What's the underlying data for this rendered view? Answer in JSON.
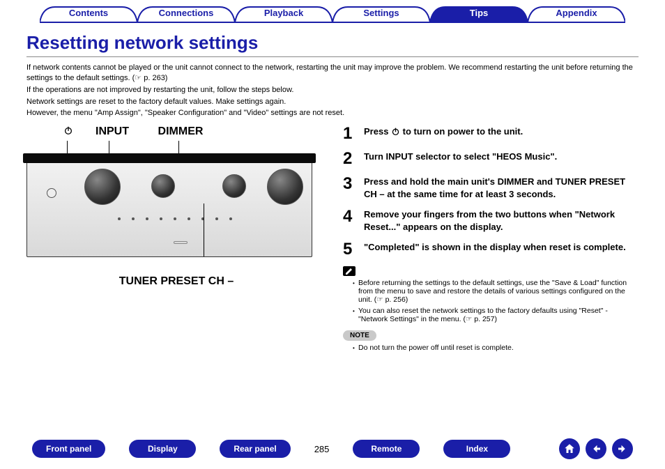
{
  "nav_tabs": {
    "items": [
      "Contents",
      "Connections",
      "Playback",
      "Settings",
      "Tips",
      "Appendix"
    ],
    "active_index": 4
  },
  "page_title": "Resetting network settings",
  "intro": {
    "p1": "If network contents cannot be played or the unit cannot connect to the network, restarting the unit may improve the problem. We recommend restarting the unit before returning the settings to the default settings. (☞ p. 263)",
    "p2": "If the operations are not improved by restarting the unit, follow the steps below.",
    "p3": "Network settings are reset to the factory default values. Make settings again.",
    "p4": "However, the menu \"Amp Assign\", \"Speaker Configuration\" and \"Video\" settings are not reset."
  },
  "device_labels": {
    "power_icon": "power",
    "input": "INPUT",
    "dimmer": "DIMMER",
    "tuner": "TUNER PRESET CH –"
  },
  "steps": [
    {
      "num": "1",
      "text_before": "Press ",
      "has_power_icon": true,
      "text_after": " to turn on power to the unit."
    },
    {
      "num": "2",
      "text": "Turn INPUT selector to select \"HEOS Music\"."
    },
    {
      "num": "3",
      "text": "Press and hold the main unit's DIMMER and TUNER PRESET CH – at the same time for at least 3 seconds."
    },
    {
      "num": "4",
      "text": "Remove your fingers from the two buttons when \"Network Reset...\" appears on the display."
    },
    {
      "num": "5",
      "text": "\"Completed\" is shown in the display when reset is complete."
    }
  ],
  "tips": [
    "Before returning the settings to the default settings, use the \"Save & Load\" function from the menu to save and restore the details of various settings configured on the unit. (☞ p. 256)",
    "You can also reset the network settings to the factory defaults using \"Reset\" - \"Network Settings\" in the menu. (☞ p. 257)"
  ],
  "note_label": "NOTE",
  "note_text": "Do not turn the power off until reset is complete.",
  "bottom_nav": {
    "buttons": [
      "Front panel",
      "Display",
      "Rear panel",
      "Remote",
      "Index"
    ],
    "page_number": "285"
  }
}
